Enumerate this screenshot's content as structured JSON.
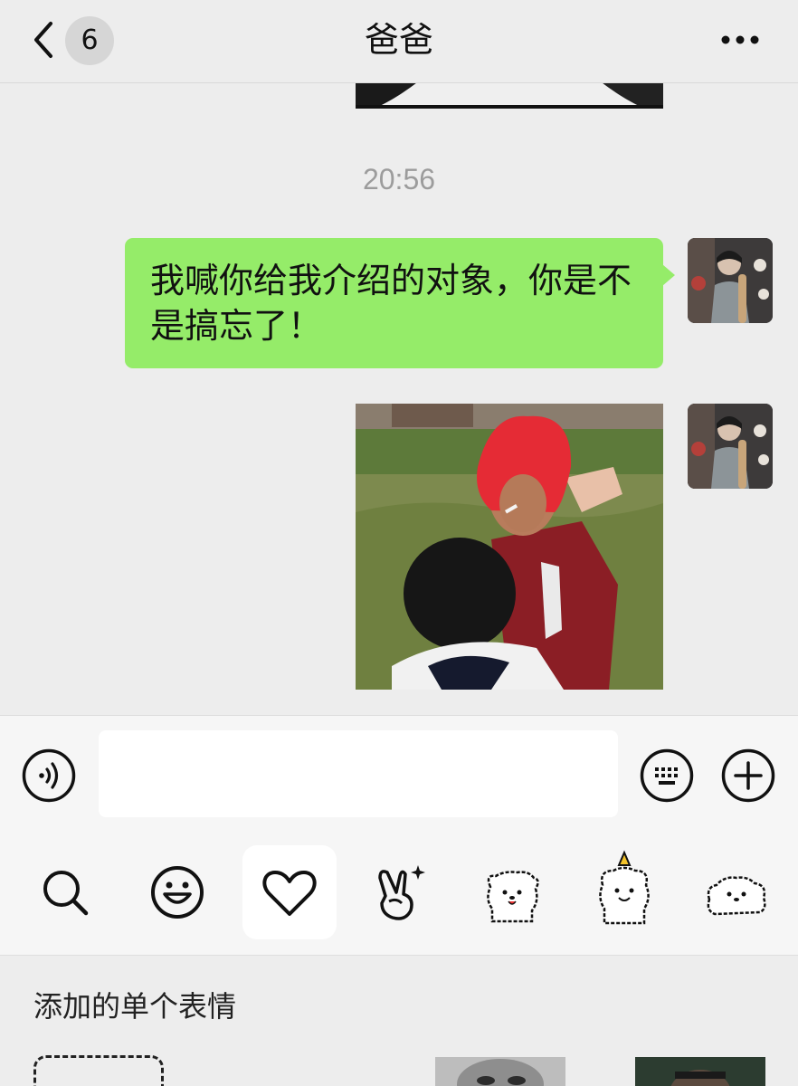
{
  "header": {
    "back_icon": "chevron-left-icon",
    "unread_count": "6",
    "title": "爸爸",
    "more_icon": "more-dots-icon"
  },
  "chat": {
    "timestamp": "20:56",
    "messages": [
      {
        "type": "text",
        "sender": "me",
        "text": "我喊你给我介绍的对象，你是不是搞忘了！"
      },
      {
        "type": "sticker",
        "sender": "me",
        "description_icon": "meme-sticker-image"
      }
    ],
    "bubble_color": "#95ec69"
  },
  "input_bar": {
    "voice_icon": "voice-icon",
    "text_value": "",
    "keyboard_icon": "keyboard-icon",
    "plus_icon": "plus-icon"
  },
  "emoji_tabs": [
    {
      "icon": "search-icon",
      "active": false
    },
    {
      "icon": "smiley-icon",
      "active": false
    },
    {
      "icon": "heart-icon",
      "active": true
    },
    {
      "icon": "victory-hand-icon",
      "active": false
    },
    {
      "icon": "dog-sticker-pack-icon",
      "active": false
    },
    {
      "icon": "dog-party-sticker-pack-icon",
      "active": false
    },
    {
      "icon": "dog-lying-sticker-pack-icon",
      "active": false
    }
  ],
  "emoji_panel": {
    "section_title": "添加的单个表情"
  }
}
